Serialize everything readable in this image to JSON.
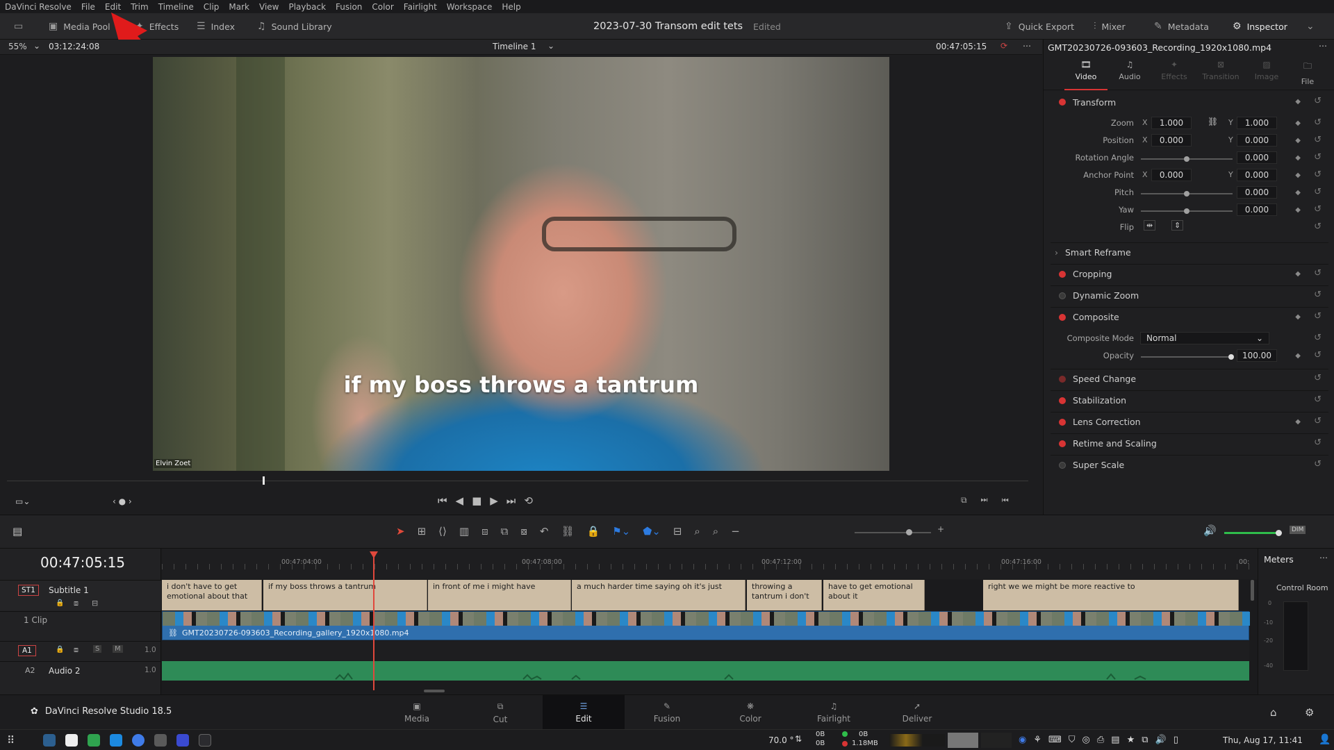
{
  "menu": [
    "DaVinci Resolve",
    "File",
    "Edit",
    "Trim",
    "Timeline",
    "Clip",
    "Mark",
    "View",
    "Playback",
    "Fusion",
    "Color",
    "Fairlight",
    "Workspace",
    "Help"
  ],
  "toolbar": {
    "media_pool": "Media Pool",
    "effects": "Effects",
    "index": "Index",
    "sound_library": "Sound Library",
    "project_title": "2023-07-30 Transom edit tets",
    "project_status": "Edited",
    "quick_export": "Quick Export",
    "mixer": "Mixer",
    "metadata": "Metadata",
    "inspector": "Inspector"
  },
  "viewer": {
    "zoom": "55%",
    "timecode_left": "03:12:24:08",
    "timeline_name": "Timeline 1",
    "timecode_right": "00:47:05:15",
    "subtitle_text": "if my boss throws a tantrum",
    "name_tag": "Elvin Zoet",
    "playhead_fraction": 0.25
  },
  "inspector": {
    "clip_name": "GMT20230726-093603_Recording_1920x1080.mp4",
    "tabs": [
      "Video",
      "Audio",
      "Effects",
      "Transition",
      "Image",
      "File"
    ],
    "transform": "Transform",
    "zoom_label": "Zoom",
    "zoom_x": "1.000",
    "zoom_y": "1.000",
    "position_label": "Position",
    "position_x": "0.000",
    "position_y": "0.000",
    "rotation_label": "Rotation Angle",
    "rotation": "0.000",
    "anchor_label": "Anchor Point",
    "anchor_x": "0.000",
    "anchor_y": "0.000",
    "pitch_label": "Pitch",
    "pitch": "0.000",
    "yaw_label": "Yaw",
    "yaw": "0.000",
    "flip_label": "Flip",
    "x": "X",
    "y": "Y",
    "smart_reframe": "Smart Reframe",
    "cropping": "Cropping",
    "dynamic_zoom": "Dynamic Zoom",
    "composite": "Composite",
    "composite_mode_label": "Composite Mode",
    "composite_mode": "Normal",
    "opacity_label": "Opacity",
    "opacity": "100.00",
    "speed_change": "Speed Change",
    "stabilization": "Stabilization",
    "lens_correction": "Lens Correction",
    "retime": "Retime and Scaling",
    "super_scale": "Super Scale"
  },
  "timeline": {
    "timecode": "00:47:05:15",
    "ruler": [
      "00:47:04:00",
      "00:47:08:00",
      "00:47:12:00",
      "00:47:16:00",
      "00:"
    ],
    "tracks": {
      "st1": "ST1",
      "st1_name": "Subtitle 1",
      "v1_clip_count": "1 Clip",
      "a1": "A1",
      "a2": "A2",
      "a2_name": "Audio 2",
      "vol1": "1.0",
      "vol2": "1.0",
      "s": "S",
      "m": "M"
    },
    "subtitles": [
      "i don't have to get emotional about that",
      "if my boss throws a tantrum",
      "in front of me i might have",
      "a much harder time saying oh it's just",
      "throwing a tantrum i don't",
      "have to get emotional about it",
      "right we we might be more reactive to"
    ],
    "video_clip": "GMT20230726-093603_Recording_gallery_1920x1080.mp4"
  },
  "meters": {
    "title": "Meters",
    "control_room": "Control Room",
    "scale": [
      "0",
      "-10",
      "-20",
      "-40"
    ]
  },
  "brand": "DaVinci Resolve Studio 18.5",
  "pages": [
    "Media",
    "Cut",
    "Edit",
    "Fusion",
    "Color",
    "Fairlight",
    "Deliver"
  ],
  "taskbar": {
    "temp": "70.0 °",
    "net_up": "0B",
    "net_down": "0B",
    "net2_up": "0B",
    "net2_down": "1.18MB",
    "datetime": "Thu, Aug 17, 11:41"
  },
  "colors": {
    "accent_red": "#d83434",
    "playhead": "#e0483c",
    "subtitle_clip": "#cdbda5",
    "video_track": "#2f6fae",
    "audio_track": "#2e8b57",
    "annotation_arrow": "#e01b1b"
  }
}
